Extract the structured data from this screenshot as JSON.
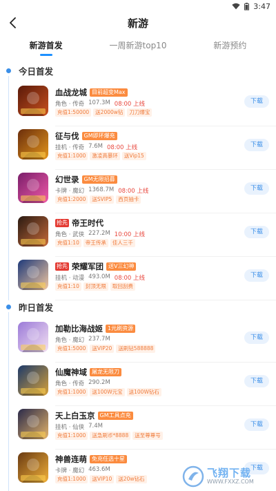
{
  "status": {
    "time": "3:47",
    "wifi_icon": "wifi-icon",
    "battery_icon": "battery-icon"
  },
  "header": {
    "title": "新游",
    "back_icon": "back-arrow-icon"
  },
  "tabs": [
    {
      "label": "新游首发",
      "active": true
    },
    {
      "label": "一周新游top10",
      "active": false
    },
    {
      "label": "新游预约",
      "active": false
    }
  ],
  "sections": [
    {
      "title": "今日首发",
      "games": [
        {
          "name": "血战龙城",
          "new": "",
          "badge": "目前超变Max",
          "meta": "角色 · 传奇",
          "size": "107.3M",
          "time": "08:00 上线",
          "tags": [
            "充值1:50000",
            "送2000w钻",
            "刀刀爆宝"
          ],
          "download": "下载",
          "icon_colors": [
            "#5a1a0a",
            "#c8501e"
          ]
        },
        {
          "name": "征与伐",
          "new": "",
          "badge": "GM即环爆充",
          "meta": "挂机 · 传奇",
          "size": "7.6M",
          "time": "08:00 上线",
          "tags": [
            "充值1:1000",
            "激凌高暴环",
            "送Vip15"
          ],
          "download": "下载",
          "icon_colors": [
            "#6b2e0c",
            "#e3951c"
          ]
        },
        {
          "name": "幻世录",
          "new": "",
          "badge": "GM无限招募",
          "meta": "卡牌 · 魔幻",
          "size": "1368.7M",
          "time": "08:00 上线",
          "tags": [
            "充值1:2000",
            "送SVIP5",
            "西页抽卡"
          ],
          "download": "下载",
          "icon_colors": [
            "#7a1e6a",
            "#f05aa8"
          ]
        },
        {
          "name": "帝王时代",
          "new": "抢先",
          "badge": "",
          "meta": "角色 · 武侠",
          "size": "227.2M",
          "time": "10:00 上线",
          "tags": [
            "充值1:10",
            "帝王传承",
            "佳人三千"
          ],
          "download": "下载",
          "icon_colors": [
            "#2a1a12",
            "#c56a3a"
          ]
        },
        {
          "name": "荣耀军团",
          "new": "抢先",
          "badge": "送V三幻神",
          "meta": "挂机 · 动漫",
          "size": "493.0M",
          "time": "08:00 上线",
          "tags": [
            "充值1:10",
            "封顶无限",
            "取回刮费"
          ],
          "download": "下载",
          "icon_colors": [
            "#1e3a7a",
            "#f2c7a0"
          ]
        }
      ]
    },
    {
      "title": "昨日首发",
      "games": [
        {
          "name": "加勒比海战姬",
          "new": "",
          "badge": "1元刷资源",
          "meta": "角色 · 魔幻",
          "size": "237.7M",
          "time": "",
          "tags": [
            "充值1:5000",
            "送VIP20",
            "送刷钻588888"
          ],
          "download": "下载",
          "icon_colors": [
            "#9b7ad8",
            "#f3e0f2"
          ]
        },
        {
          "name": "仙魔神域",
          "new": "",
          "badge": "屠龙无限刀",
          "meta": "角色 · 传奇",
          "size": "290.2M",
          "time": "",
          "tags": [
            "充值1:1000",
            "送100W元宝",
            "送100W钻石"
          ],
          "download": "下载",
          "icon_colors": [
            "#1d3a6a",
            "#d6a13a"
          ]
        },
        {
          "name": "天上白玉京",
          "new": "",
          "badge": "GM工具点充",
          "meta": "挂机 · 仙侠",
          "size": "7.4M",
          "time": "",
          "tags": [
            "充值1:1000",
            "送急刷币*8888",
            "送至尊尊号"
          ],
          "download": "下载",
          "icon_colors": [
            "#2a2a4a",
            "#e4b46a"
          ]
        },
        {
          "name": "神兽连萌",
          "new": "",
          "badge": "免充任选十星",
          "meta": "卡牌 · 魔幻",
          "size": "463.6M",
          "time": "",
          "tags": [
            "充值1:1000",
            "送VIP10",
            "送20w钻石"
          ],
          "download": "下载",
          "icon_colors": [
            "#6a3a12",
            "#f0b03a"
          ]
        }
      ]
    }
  ],
  "watermark": {
    "name": "飞翔下载",
    "url": "WWW.FXXZ.COM"
  }
}
